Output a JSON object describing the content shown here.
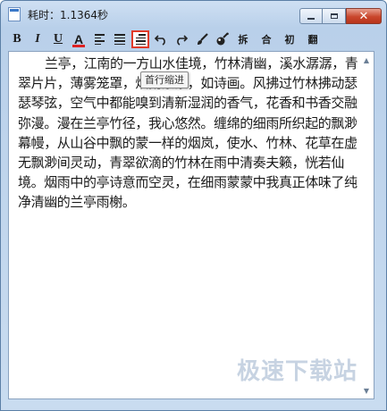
{
  "window": {
    "title": "耗时：1.1364秒",
    "icon": "notepad-icon"
  },
  "toolbar": {
    "bold": "B",
    "italic": "I",
    "underline": "U",
    "font_color": "A",
    "split": "拆",
    "merge": "合",
    "initial": "初",
    "flip": "翻",
    "font_color_value": "#d22222"
  },
  "tooltip": "首行缩进",
  "editor": {
    "text": "兰亭，江南的一方山水佳境，竹林清幽，溪水潺潺，青翠片片，薄雾笼罩，烟雨蒙蒙，如诗画。风拂过竹林拂动瑟瑟琴弦，空气中都能嗅到清新湿润的香气，花香和书香交融弥漫。漫在兰亭竹径，我心悠然。缠绵的细雨所织起的飘渺幕幔，从山谷中飘的蒙一样的烟岚，使水、竹林、花草在虚无飘渺间灵动，青翠欲滴的竹林在雨中清奏夫籁，恍若仙境。烟雨中的亭诗意而空灵，在细雨蒙蒙中我真正体味了纯净清幽的兰亭雨榭。"
  },
  "watermark": "极速下载站"
}
